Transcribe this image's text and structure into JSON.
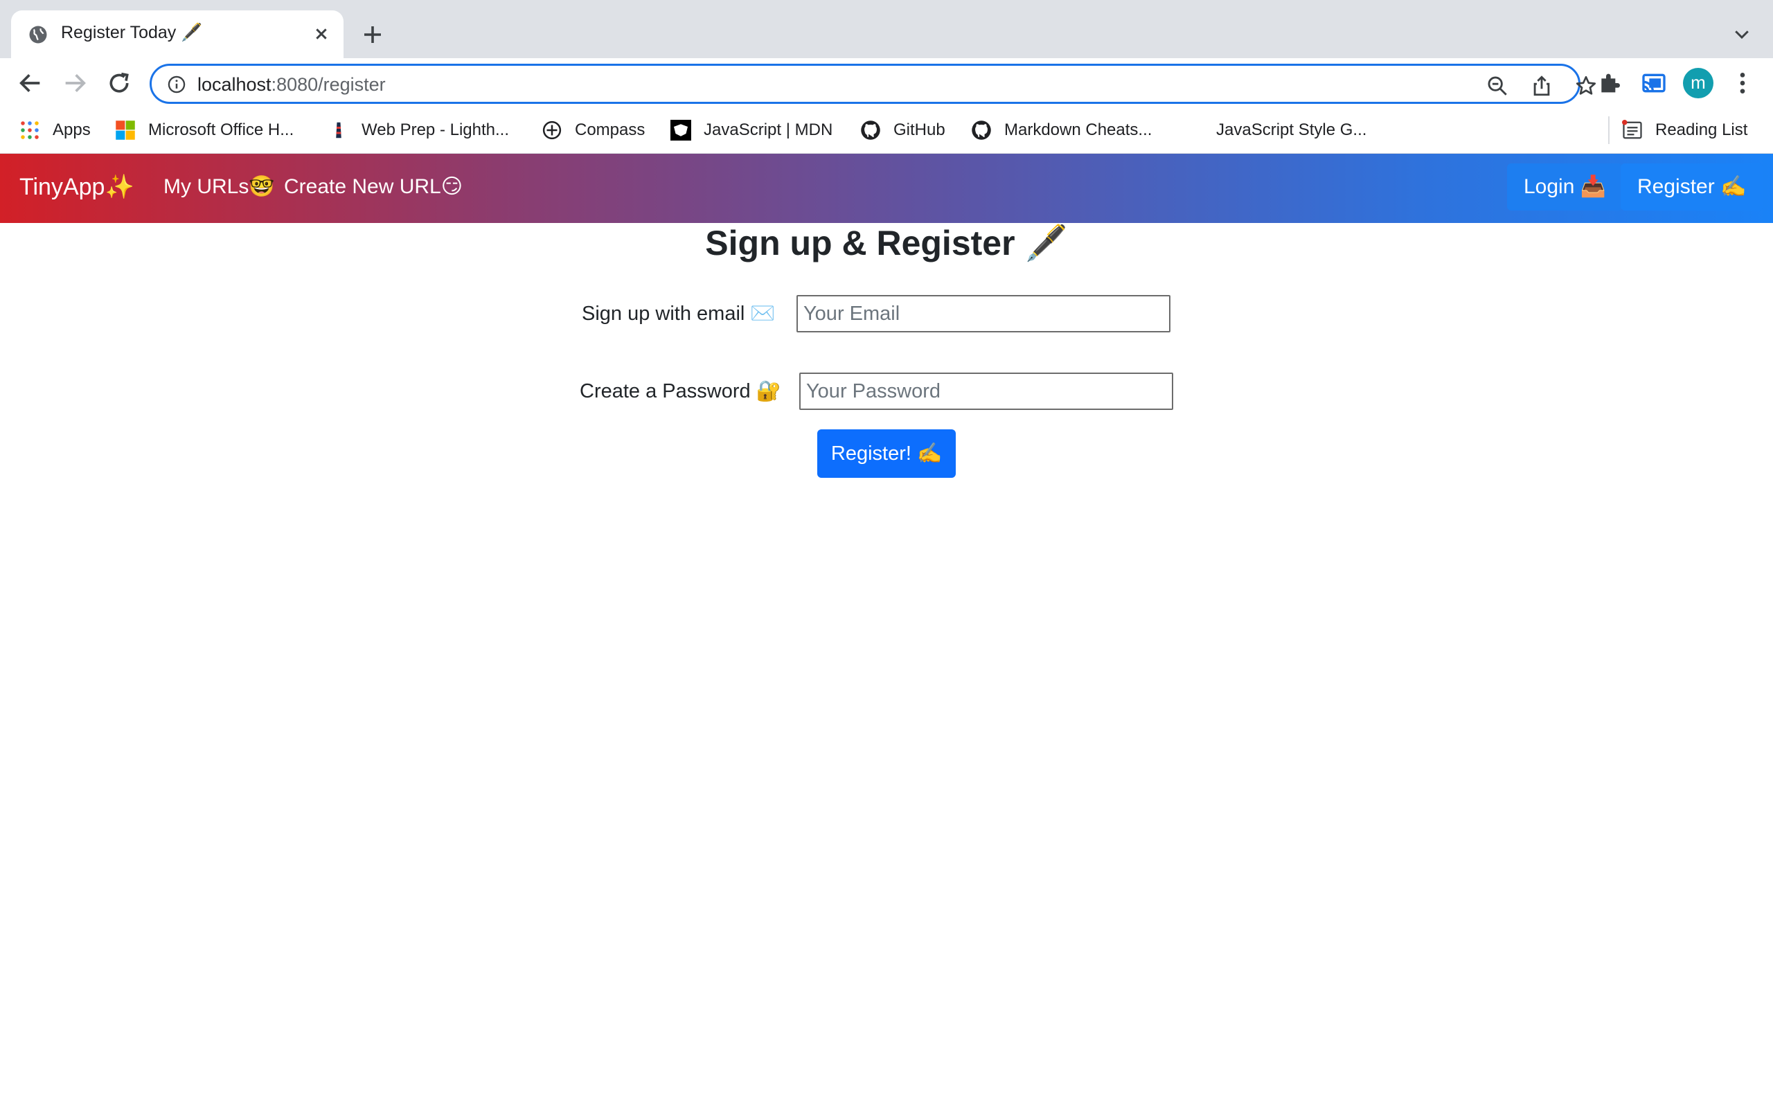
{
  "browser": {
    "tab": {
      "title": "Register Today 🖋️"
    },
    "address_bar": {
      "host": "localhost",
      "rest": ":8080/register"
    },
    "bookmarks": [
      {
        "label": "Apps",
        "icon": "apps-grid-icon"
      },
      {
        "label": "Microsoft Office H...",
        "icon": "microsoft-office-icon"
      },
      {
        "label": "Web Prep - Lighth...",
        "icon": "lighthouse-icon"
      },
      {
        "label": "Compass",
        "icon": "compass-icon"
      },
      {
        "label": "JavaScript | MDN",
        "icon": "mdn-icon"
      },
      {
        "label": "GitHub",
        "icon": "github-icon"
      },
      {
        "label": "Markdown Cheats...",
        "icon": "github-icon"
      },
      {
        "label": "JavaScript Style G...",
        "icon": ""
      }
    ],
    "reading_list": "Reading List",
    "profile_initial": "m"
  },
  "app": {
    "brand": "TinyApp✨",
    "nav": {
      "my_urls": "My URLs🤓",
      "create_new_url": "Create New URL😏",
      "login": "Login 📥",
      "register": "Register ✍️"
    },
    "page": {
      "title": "Sign up & Register 🖋️",
      "email_label": "Sign up with email ✉️",
      "email_placeholder": "Your Email",
      "password_label": "Create a Password 🔐",
      "password_placeholder": "Your Password",
      "submit_label": "Register! ✍️"
    }
  },
  "colors": {
    "navbar_gradient_start": "#d22027",
    "navbar_gradient_end": "#1a82f7",
    "primary_button": "#0d6efd",
    "focus_ring": "#1a73e8"
  }
}
